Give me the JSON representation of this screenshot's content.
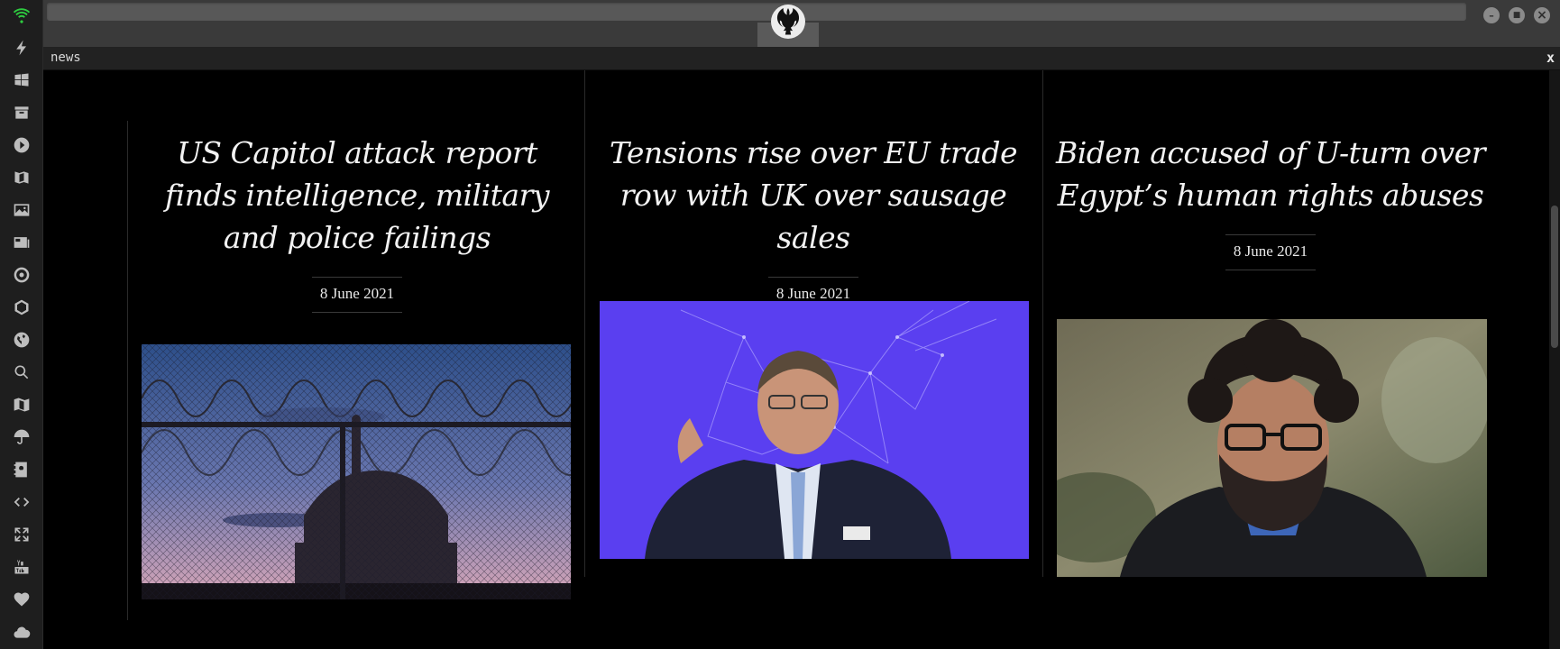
{
  "sidebar": {
    "icons": [
      {
        "name": "wifi-icon"
      },
      {
        "name": "lightning-icon"
      },
      {
        "name": "windows-icon"
      },
      {
        "name": "archive-icon"
      },
      {
        "name": "play-circle-icon"
      },
      {
        "name": "book-map-icon"
      },
      {
        "name": "image-icon"
      },
      {
        "name": "newspaper-icon"
      },
      {
        "name": "galactic-empire-icon"
      },
      {
        "name": "jedi-order-icon"
      },
      {
        "name": "globe-icon"
      },
      {
        "name": "search-icon"
      },
      {
        "name": "map-icon"
      },
      {
        "name": "umbrella-icon"
      },
      {
        "name": "contacts-icon"
      },
      {
        "name": "code-icon"
      },
      {
        "name": "expand-icon"
      },
      {
        "name": "youtube-icon"
      },
      {
        "name": "heart-icon"
      },
      {
        "name": "cloud-icon"
      }
    ],
    "accent_color": "#2ecc40"
  },
  "window": {
    "logo_icon": "rebel-alliance-icon",
    "buttons": {
      "minimize": "–",
      "maximize": "■",
      "close": "×"
    }
  },
  "tab": {
    "title": "news",
    "close_label": "x"
  },
  "articles": [
    {
      "headline": "US Capitol attack report finds intelligence, military and police failings",
      "date": "8 June 2021",
      "image": "us-capitol-behind-fence"
    },
    {
      "headline": "Tensions rise over EU trade row with UK over sausage sales",
      "date": "8 June 2021",
      "image": "eu-official-speaking"
    },
    {
      "headline": "Biden accused of U-turn over Egypt’s human rights abuses",
      "date": "8 June 2021",
      "image": "bearded-man-portrait"
    }
  ]
}
